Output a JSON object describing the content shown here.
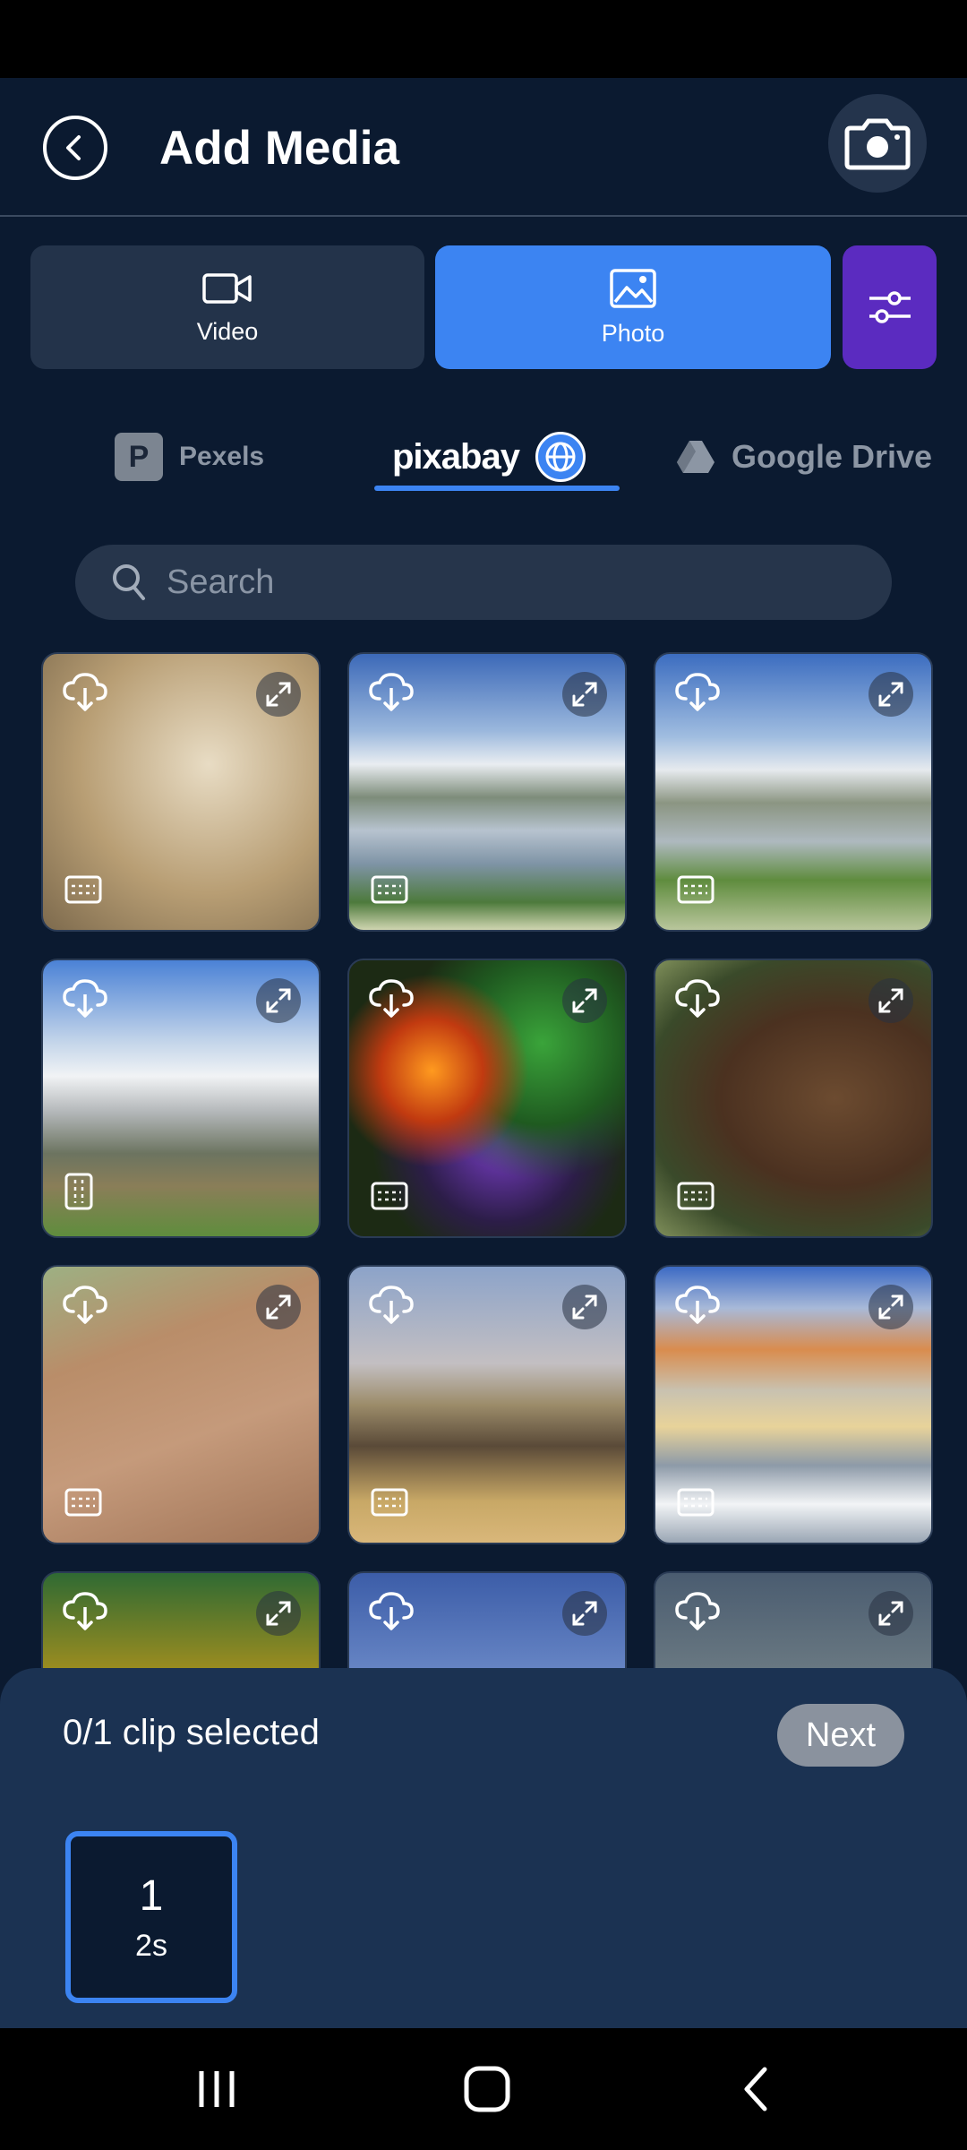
{
  "header": {
    "title": "Add Media"
  },
  "media_types": [
    {
      "label": "Video",
      "icon": "video-camera-icon",
      "selected": false
    },
    {
      "label": "Photo",
      "icon": "image-icon",
      "selected": true
    }
  ],
  "sources": {
    "pexels": "Pexels",
    "pexels_logo": "P",
    "pixabay": "pixabay",
    "google_drive": "Google Drive",
    "selected": "pixabay"
  },
  "search": {
    "placeholder": "Search"
  },
  "grid": {
    "columns": 3,
    "items": [
      {
        "name": "wheat-photo",
        "orientation": "landscape"
      },
      {
        "name": "mountain-lake-photo",
        "orientation": "landscape"
      },
      {
        "name": "alpine-lake-photo",
        "orientation": "landscape"
      },
      {
        "name": "matterhorn-photo",
        "orientation": "portrait"
      },
      {
        "name": "abstract-fractal-photo",
        "orientation": "landscape"
      },
      {
        "name": "brown-bear-photo",
        "orientation": "landscape"
      },
      {
        "name": "lizard-on-wood-photo",
        "orientation": "landscape"
      },
      {
        "name": "elephants-photo",
        "orientation": "landscape"
      },
      {
        "name": "harbor-town-photo",
        "orientation": "landscape"
      },
      {
        "name": "sunflowers-photo",
        "orientation": "landscape"
      },
      {
        "name": "atomium-photo",
        "orientation": "landscape"
      },
      {
        "name": "beach-photo",
        "orientation": "landscape"
      }
    ]
  },
  "selection": {
    "summary": "0/1 clip selected",
    "next_label": "Next",
    "slots": [
      {
        "number": "1",
        "duration": "2s"
      }
    ]
  },
  "colors": {
    "background": "#0b1a30",
    "accent_blue": "#3c84f2",
    "filter_purple": "#5b2bc0",
    "sheet": "#1b3252"
  }
}
